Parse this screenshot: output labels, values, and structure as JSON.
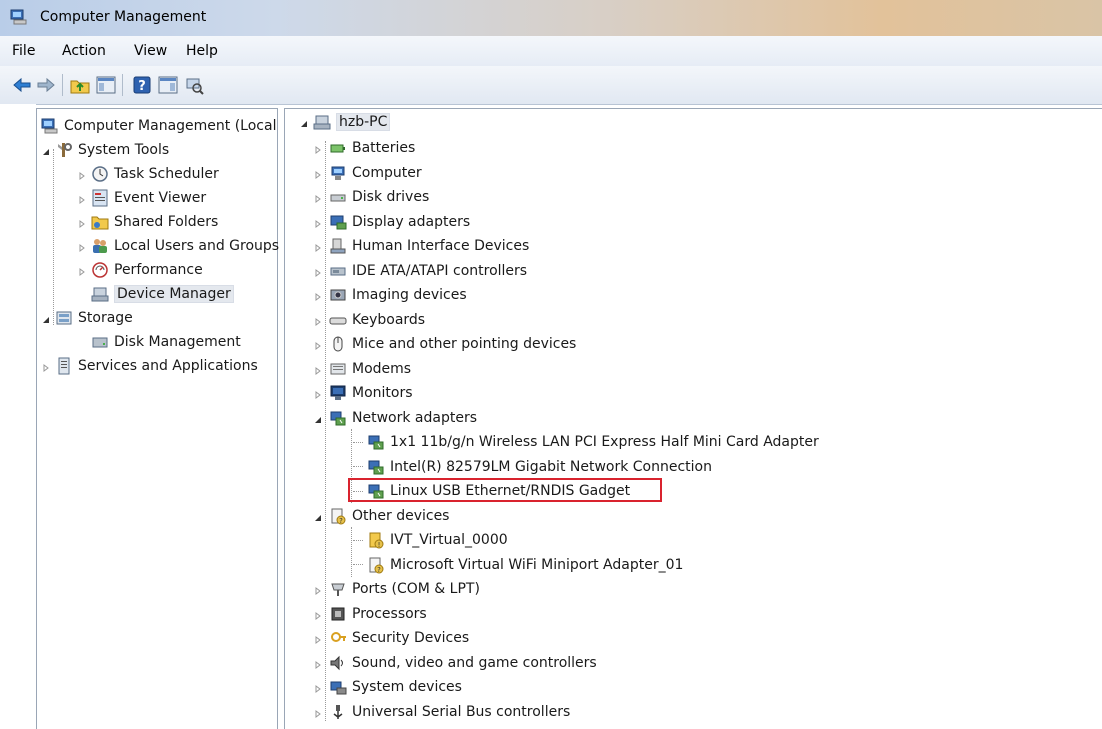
{
  "window": {
    "title": "Computer Management"
  },
  "menu": [
    "File",
    "Action",
    "View",
    "Help"
  ],
  "left_tree": [
    {
      "label": "Computer Management (Local",
      "icon": "computer-management-icon",
      "level": 0,
      "expand": "none"
    },
    {
      "label": "System Tools",
      "icon": "system-tools-icon",
      "level": 1,
      "expand": "expanded"
    },
    {
      "label": "Task Scheduler",
      "icon": "clock-icon",
      "level": 2,
      "expand": "collapsed"
    },
    {
      "label": "Event Viewer",
      "icon": "event-viewer-icon",
      "level": 2,
      "expand": "collapsed"
    },
    {
      "label": "Shared Folders",
      "icon": "shared-folder-icon",
      "level": 2,
      "expand": "collapsed"
    },
    {
      "label": "Local Users and Groups",
      "icon": "users-icon",
      "level": 2,
      "expand": "collapsed"
    },
    {
      "label": "Performance",
      "icon": "performance-icon",
      "level": 2,
      "expand": "collapsed"
    },
    {
      "label": "Device Manager",
      "icon": "device-manager-icon",
      "level": 2,
      "expand": "none",
      "selected": true
    },
    {
      "label": "Storage",
      "icon": "storage-icon",
      "level": 1,
      "expand": "expanded"
    },
    {
      "label": "Disk Management",
      "icon": "disk-management-icon",
      "level": 2,
      "expand": "none"
    },
    {
      "label": "Services and Applications",
      "icon": "services-icon",
      "level": 1,
      "expand": "collapsed"
    }
  ],
  "device_tree": {
    "root": "hzb-PC",
    "items": [
      {
        "label": "Batteries",
        "icon": "battery-icon",
        "level": 1,
        "expand": "collapsed"
      },
      {
        "label": "Computer",
        "icon": "computer-icon",
        "level": 1,
        "expand": "collapsed"
      },
      {
        "label": "Disk drives",
        "icon": "disk-drive-icon",
        "level": 1,
        "expand": "collapsed"
      },
      {
        "label": "Display adapters",
        "icon": "display-adapter-icon",
        "level": 1,
        "expand": "collapsed"
      },
      {
        "label": "Human Interface Devices",
        "icon": "hid-icon",
        "level": 1,
        "expand": "collapsed"
      },
      {
        "label": "IDE ATA/ATAPI controllers",
        "icon": "ide-controller-icon",
        "level": 1,
        "expand": "collapsed"
      },
      {
        "label": "Imaging devices",
        "icon": "imaging-device-icon",
        "level": 1,
        "expand": "collapsed"
      },
      {
        "label": "Keyboards",
        "icon": "keyboard-icon",
        "level": 1,
        "expand": "collapsed"
      },
      {
        "label": "Mice and other pointing devices",
        "icon": "mouse-icon",
        "level": 1,
        "expand": "collapsed"
      },
      {
        "label": "Modems",
        "icon": "modem-icon",
        "level": 1,
        "expand": "collapsed"
      },
      {
        "label": "Monitors",
        "icon": "monitor-icon",
        "level": 1,
        "expand": "collapsed"
      },
      {
        "label": "Network adapters",
        "icon": "network-adapter-icon",
        "level": 1,
        "expand": "expanded"
      },
      {
        "label": "1x1 11b/g/n Wireless LAN PCI Express Half Mini Card Adapter",
        "icon": "network-adapter-icon",
        "level": 2,
        "expand": "none"
      },
      {
        "label": "Intel(R) 82579LM Gigabit Network Connection",
        "icon": "network-adapter-icon",
        "level": 2,
        "expand": "none"
      },
      {
        "label": "Linux USB Ethernet/RNDIS Gadget",
        "icon": "network-adapter-icon",
        "level": 2,
        "expand": "none",
        "highlighted": true
      },
      {
        "label": "Other devices",
        "icon": "unknown-device-icon",
        "level": 1,
        "expand": "expanded"
      },
      {
        "label": "IVT_Virtual_0000",
        "icon": "unknown-device-warning-icon",
        "level": 2,
        "expand": "none"
      },
      {
        "label": "Microsoft Virtual WiFi Miniport Adapter_01",
        "icon": "unknown-device-icon",
        "level": 2,
        "expand": "none"
      },
      {
        "label": "Ports (COM & LPT)",
        "icon": "port-icon",
        "level": 1,
        "expand": "collapsed"
      },
      {
        "label": "Processors",
        "icon": "processor-icon",
        "level": 1,
        "expand": "collapsed"
      },
      {
        "label": "Security Devices",
        "icon": "security-device-icon",
        "level": 1,
        "expand": "collapsed"
      },
      {
        "label": "Sound, video and game controllers",
        "icon": "sound-icon",
        "level": 1,
        "expand": "collapsed"
      },
      {
        "label": "System devices",
        "icon": "system-device-icon",
        "level": 1,
        "expand": "collapsed"
      },
      {
        "label": "Universal Serial Bus controllers",
        "icon": "usb-icon",
        "level": 1,
        "expand": "collapsed"
      }
    ]
  },
  "colors": {
    "highlight_border": "#d9232e",
    "selection_bg": "#e4e8ee"
  }
}
